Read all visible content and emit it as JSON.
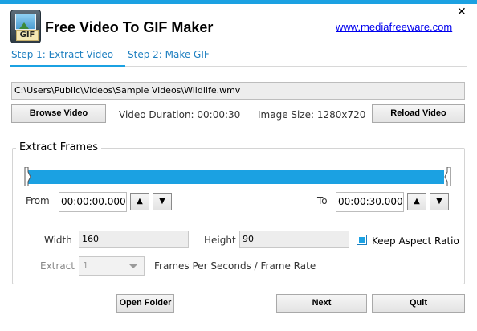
{
  "app": {
    "title": "Free Video To GIF Maker",
    "logo_text": "GIF",
    "website": "www.mediafreeware.com",
    "window_controls": {
      "minimize": "–",
      "close": "✕"
    },
    "accent_color": "#1ba1e2"
  },
  "tabs": [
    {
      "label": "Step 1: Extract Video",
      "active": true
    },
    {
      "label": "Step 2: Make GIF",
      "active": false
    }
  ],
  "source": {
    "path": "C:\\Users\\Public\\Videos\\Sample Videos\\Wildlife.wmv",
    "browse_label": "Browse Video",
    "reload_label": "Reload Video",
    "duration_text": "Video Duration:  00:00:30",
    "image_size_text": "Image Size: 1280x720"
  },
  "extract": {
    "group_title": "Extract Frames",
    "range_start_fraction": 0.0,
    "range_end_fraction": 1.0,
    "from_label": "From",
    "from_value": "00:00:00.000",
    "to_label": "To",
    "to_value": "00:00:30.000",
    "spin_up": "▲",
    "spin_down": "▼",
    "width_label": "Width",
    "width_value": "160",
    "height_label": "Height",
    "height_value": "90",
    "keep_aspect_label": "Keep Aspect Ratio",
    "keep_aspect_checked": true,
    "extract_label": "Extract",
    "extract_value": "1",
    "fps_label": "Frames Per Seconds / Frame Rate"
  },
  "footer": {
    "open_folder_label": "Open Folder",
    "next_label": "Next",
    "quit_label": "Quit"
  }
}
